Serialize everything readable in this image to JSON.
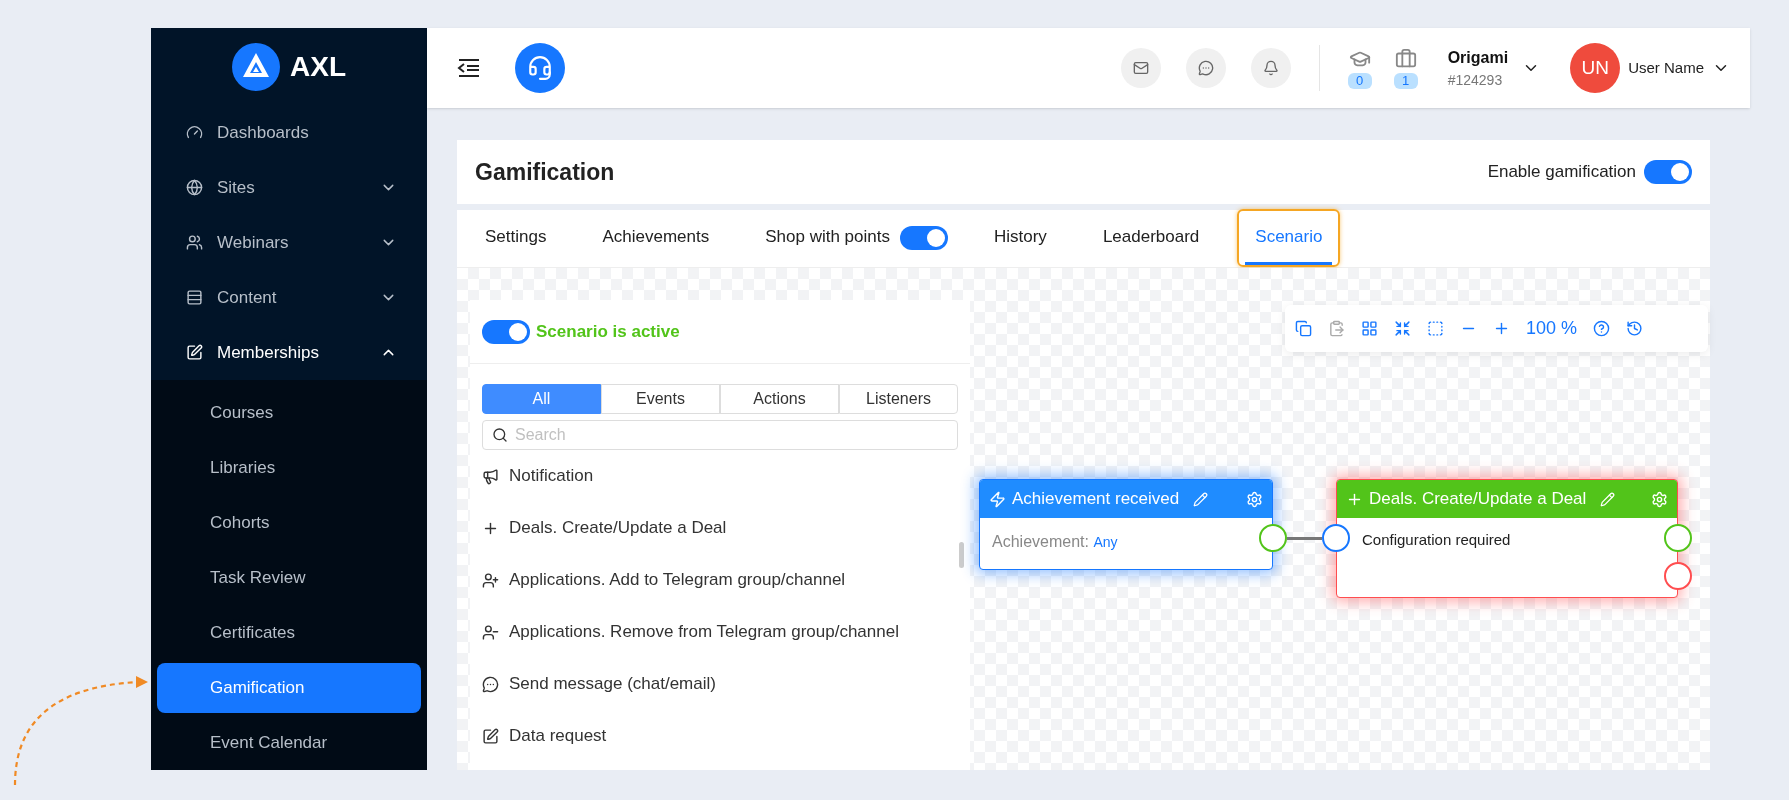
{
  "sidebar": {
    "logo": "AXL",
    "items": [
      {
        "label": "Dashboards"
      },
      {
        "label": "Sites",
        "expanded": false
      },
      {
        "label": "Webinars",
        "expanded": false
      },
      {
        "label": "Content",
        "expanded": false
      },
      {
        "label": "Memberships",
        "expanded": true,
        "children": [
          {
            "label": "Courses",
            "selected": false
          },
          {
            "label": "Libraries",
            "selected": false
          },
          {
            "label": "Cohorts",
            "selected": false
          },
          {
            "label": "Task Review",
            "selected": false
          },
          {
            "label": "Certificates",
            "selected": false
          },
          {
            "label": "Gamification",
            "selected": true
          },
          {
            "label": "Event Calendar",
            "selected": false
          }
        ]
      }
    ]
  },
  "topbar": {
    "counters": [
      "0",
      "1"
    ],
    "account": {
      "name": "Origami",
      "id": "#124293"
    },
    "user": {
      "initials": "UN",
      "name": "User Name"
    }
  },
  "page": {
    "title": "Gamification",
    "enable": {
      "label": "Enable gamification",
      "on": true
    }
  },
  "tabs": [
    {
      "label": "Settings",
      "selected": false,
      "highlighted": false
    },
    {
      "label": "Achievements",
      "selected": false,
      "highlighted": false
    },
    {
      "label": "Shop with points",
      "selected": false,
      "highlighted": false,
      "toggle_on": true
    },
    {
      "label": "History",
      "selected": false,
      "highlighted": false
    },
    {
      "label": "Leaderboard",
      "selected": false,
      "highlighted": false
    },
    {
      "label": "Scenario",
      "selected": true,
      "highlighted": true
    }
  ],
  "scenario": {
    "active": true,
    "status": "Scenario is active",
    "filters": [
      {
        "label": "All",
        "selected": true
      },
      {
        "label": "Events",
        "selected": false
      },
      {
        "label": "Actions",
        "selected": false
      },
      {
        "label": "Listeners",
        "selected": false
      }
    ],
    "search": {
      "placeholder": "Search"
    },
    "items": [
      {
        "label": "Notification"
      },
      {
        "label": "Deals. Create/Update a Deal"
      },
      {
        "label": "Applications. Add to Telegram group/channel"
      },
      {
        "label": "Applications. Remove from Telegram group/channel"
      },
      {
        "label": "Send message (chat/email)"
      },
      {
        "label": "Data request"
      }
    ]
  },
  "toolbar": {
    "zoom": "100 %"
  },
  "nodes": [
    {
      "kind": "event",
      "title": "Achievement received",
      "field_label": "Achievement:",
      "field_value": "Any"
    },
    {
      "kind": "action",
      "title": "Deals. Create/Update a Deal",
      "body": "Configuration required"
    }
  ]
}
